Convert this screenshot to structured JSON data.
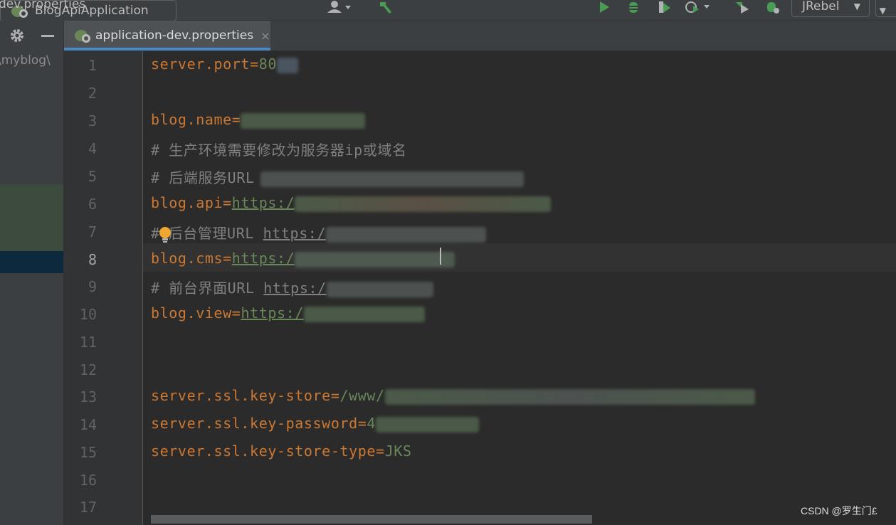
{
  "window": {
    "file_crumb": "dev.properties"
  },
  "toolbar": {
    "run_config_label": "BlogApiApplication",
    "jrebel_label": "JRebel"
  },
  "left_panel": {
    "path_text": "\\myblog\\"
  },
  "tab": {
    "title": "application-dev.properties",
    "close_glyph": "×"
  },
  "editor": {
    "line_numbers": [
      "1",
      "2",
      "3",
      "4",
      "5",
      "6",
      "7",
      "8",
      "9",
      "10",
      "11",
      "12",
      "13",
      "14",
      "15",
      "16",
      "17"
    ],
    "active_line": "8",
    "lines": {
      "l1_key": "server.port",
      "l1_val": "80",
      "l3_key": "blog.name",
      "l4_comment": "# 生产环境需要修改为服务器ip或域名",
      "l5_comment": "# 后端服务URL",
      "l6_key": "blog.api",
      "l6_url": "https:/",
      "l7_comment_a": "#",
      "l7_comment_b": "后台管理URL ",
      "l7_url": "https:/",
      "l8_key": "blog.cms",
      "l8_url": "https:/",
      "l9_comment": "# 前台界面URL ",
      "l9_url": "https:/",
      "l10_key": "blog.view",
      "l10_url": "https:/",
      "l13_key": "server.ssl.key-store",
      "l13_val": "/www/",
      "l14_key": "server.ssl.key-password",
      "l14_val": "4",
      "l15_key": "server.ssl.key-store-type",
      "l15_val": "JKS"
    }
  },
  "watermark": "CSDN @罗生门£"
}
